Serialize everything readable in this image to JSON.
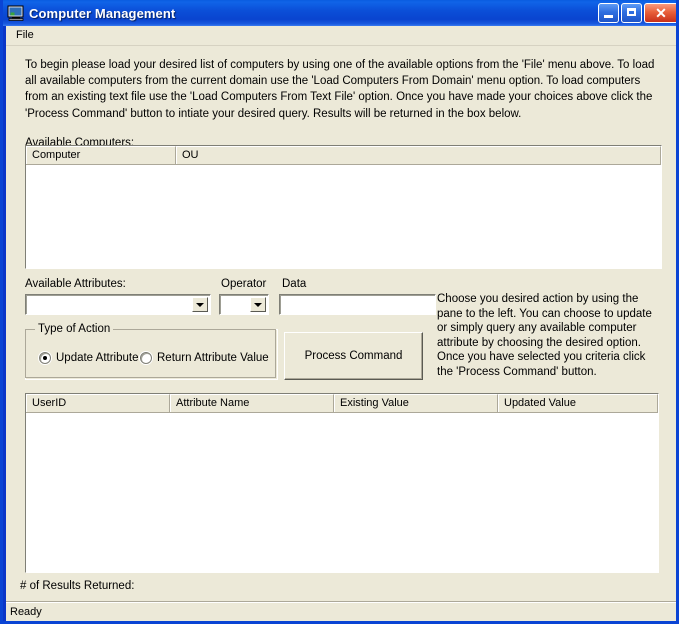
{
  "window": {
    "title": "Computer Management",
    "icon": "computer-monitor-icon",
    "controls": {
      "minimize": "Minimize",
      "maximize": "Maximize",
      "close": "Close",
      "close_glyph": "✕"
    }
  },
  "menubar": {
    "items": [
      {
        "label": "File"
      }
    ]
  },
  "instructions": {
    "text": "To begin please load your desired list of computers by using one of the available options from the 'File' menu above. To load all available computers from the current domain use the 'Load Computers From Domain' menu option. To load computers from an existing text file use the 'Load Computers From Text File' option. Once you have made your choices above click the 'Process Command' button to intiate your desired query. Results will be returned in the box below."
  },
  "available_computers": {
    "label": "Available Computers:",
    "columns": [
      "Computer",
      "OU"
    ],
    "rows": []
  },
  "query": {
    "attributes_label": "Available Attributes:",
    "attributes_value": "",
    "operator_label": "Operator",
    "operator_value": "",
    "data_label": "Data",
    "data_value": "",
    "data_placeholder": ""
  },
  "type_of_action": {
    "title": "Type of Action",
    "options": [
      {
        "label": "Update Attribute",
        "checked": true
      },
      {
        "label": "Return Attribute Value",
        "checked": false
      }
    ]
  },
  "process_button": {
    "label": "Process Command"
  },
  "help": {
    "text": "Choose you desired action by using the pane to the left. You can choose to update or simply query any available computer attribute by choosing the desired option. Once you have selected you criteria click the 'Process Command' button."
  },
  "results": {
    "columns": [
      "UserID",
      "Attribute Name",
      "Existing Value",
      "Updated Value"
    ],
    "rows": [],
    "count_label": "# of Results Returned:",
    "count_value": ""
  },
  "statusbar": {
    "text": "Ready"
  },
  "colors": {
    "face": "#ece9d8",
    "title_blue": "#0a44cf",
    "border_blue": "#0a44d4",
    "close_red": "#c8301a",
    "field_white": "#ffffff",
    "shadow_gray": "#aca899"
  }
}
